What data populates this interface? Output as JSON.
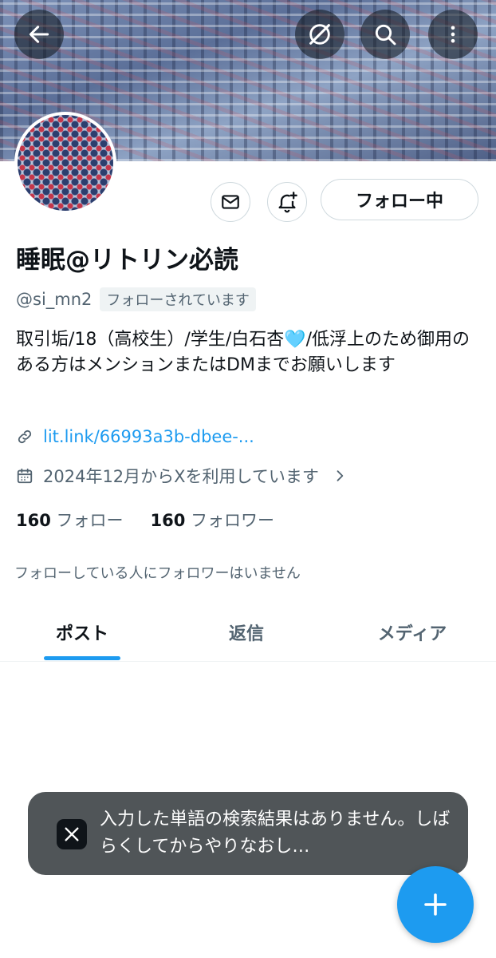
{
  "header": {
    "back_icon": "arrow-left-icon",
    "grok_icon": "grok-icon",
    "search_icon": "search-icon",
    "more_icon": "more-vertical-icon"
  },
  "profile": {
    "display_name": "睡眠@リトリン必読",
    "handle": "@si_mn2",
    "follows_you_badge": "フォローされています",
    "bio": "取引垢/18（高校生）/学生/白石杏🩵/低浮上のため御用のある方はメンションまたはDMまでお願いします",
    "link": "lit.link/66993a3b-dbee-...",
    "joined": "2024年12月からXを利用しています",
    "following_count": "160",
    "following_label": "フォロー",
    "followers_count": "160",
    "followers_label": "フォロワー",
    "mutual_text": "フォローしている人にフォロワーはいません"
  },
  "actions": {
    "follow_button_label": "フォロー中",
    "message_icon": "mail-icon",
    "notify_icon": "bell-plus-icon"
  },
  "tabs": [
    {
      "label": "ポスト",
      "active": true
    },
    {
      "label": "返信",
      "active": false
    },
    {
      "label": "メディア",
      "active": false
    }
  ],
  "toast": {
    "text": "入力した単語の検索結果はありません。しばらくしてからやりなおし…",
    "logo": "x-logo"
  },
  "fab": {
    "icon": "plus-icon"
  },
  "colors": {
    "accent": "#1d9bf0",
    "text_primary": "#0f1419",
    "text_secondary": "#536471",
    "toast_bg": "#505558"
  }
}
